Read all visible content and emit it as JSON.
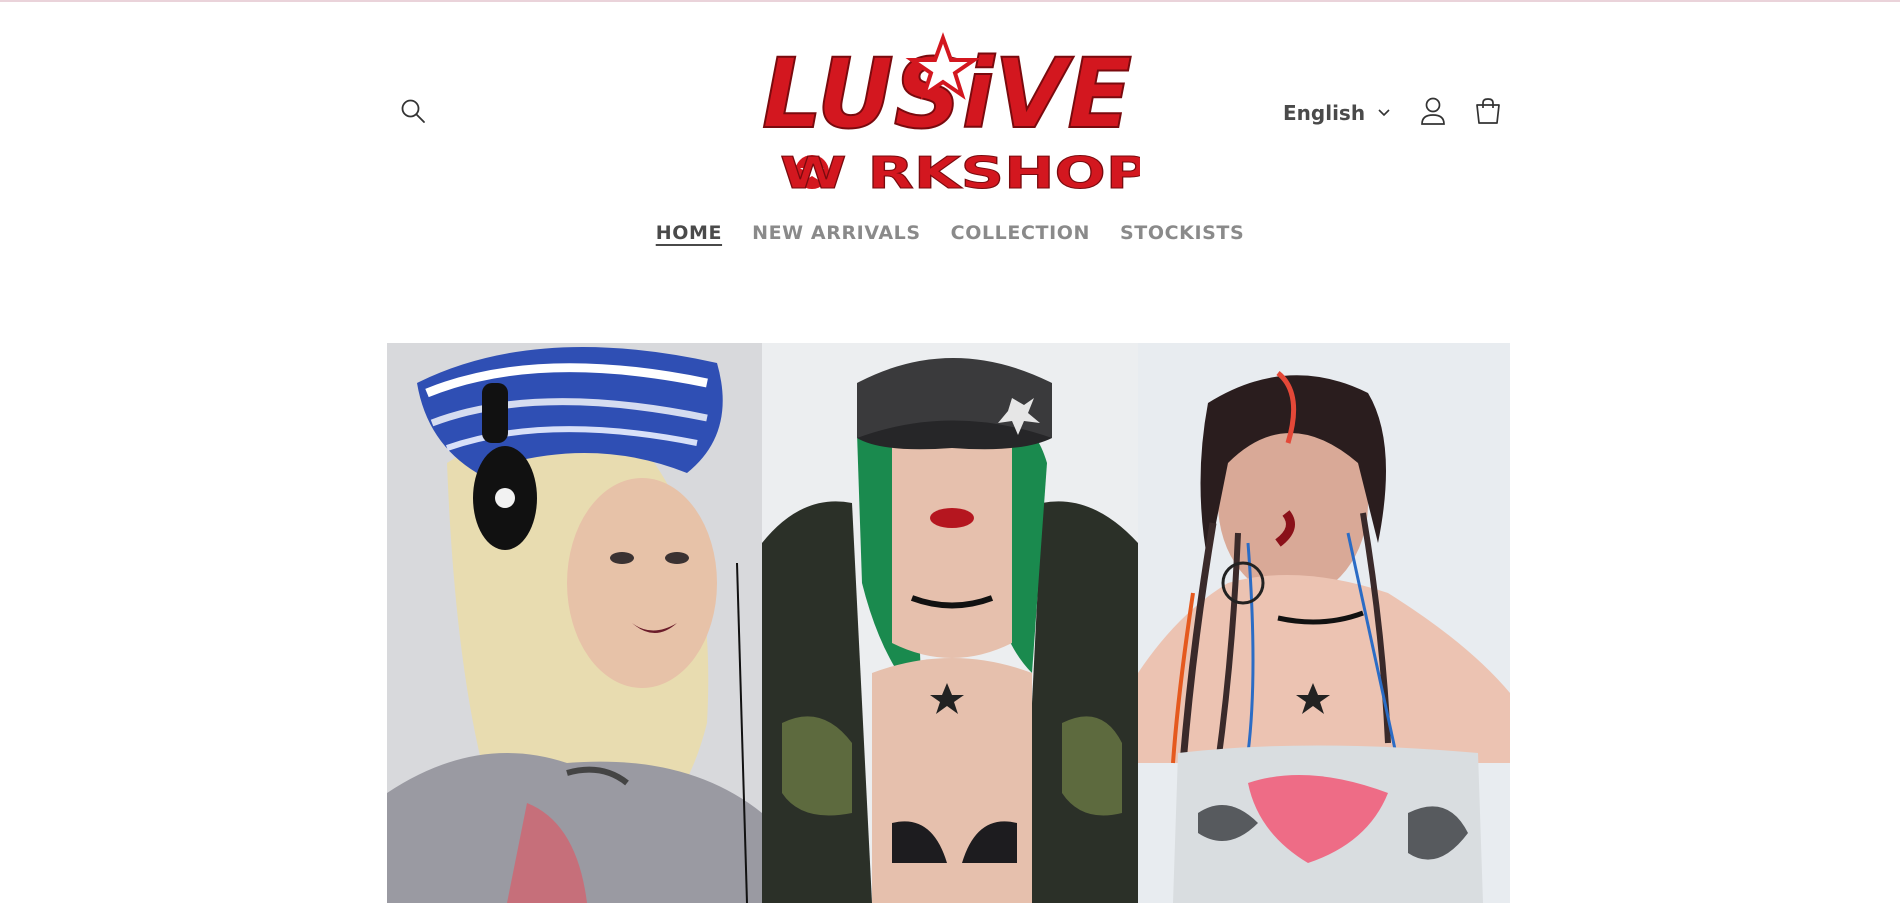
{
  "header": {
    "logo_alt": "LUSIVE WORKSHOP",
    "logo_top": "LUSiVE",
    "logo_bottom": "WORKSHOP",
    "language": "English",
    "icons": {
      "search": "search-icon",
      "account": "account-icon",
      "cart": "cart-icon",
      "language_caret": "chevron-down-icon"
    }
  },
  "nav": {
    "items": [
      {
        "label": "HOME",
        "active": true
      },
      {
        "label": "NEW ARRIVALS",
        "active": false
      },
      {
        "label": "COLLECTION",
        "active": false
      },
      {
        "label": "STOCKISTS",
        "active": false
      }
    ]
  },
  "hero": {
    "images": [
      "model-1-photo",
      "model-2-photo",
      "model-3-photo"
    ]
  },
  "colors": {
    "brand_red": "#d3171f",
    "nav_active": "#4a4a4a",
    "nav_inactive": "#8a8a8a",
    "top_border": "#ead3da"
  }
}
